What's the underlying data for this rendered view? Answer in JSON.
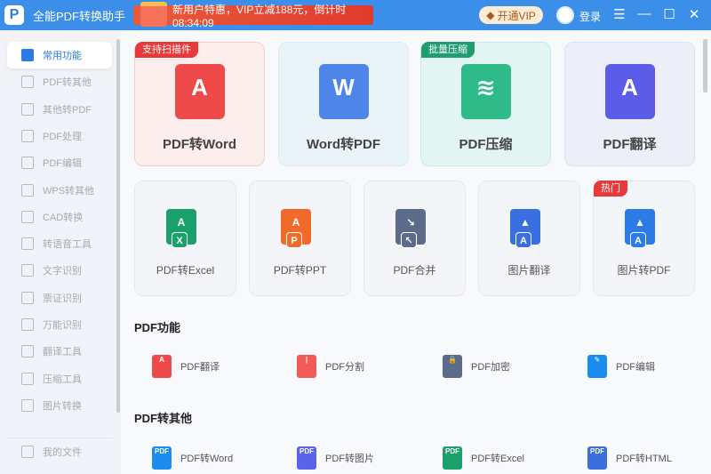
{
  "app": {
    "title": "全能PDF转换助手",
    "promo": "新用户特惠，VIP立减188元，倒计时 08:34:09",
    "vip": "开通VIP",
    "login": "登录"
  },
  "sidebar": {
    "items": [
      {
        "label": "常用功能"
      },
      {
        "label": "PDF转其他"
      },
      {
        "label": "其他转PDF"
      },
      {
        "label": "PDF处理"
      },
      {
        "label": "PDF编辑"
      },
      {
        "label": "WPS转其他"
      },
      {
        "label": "CAD转换"
      },
      {
        "label": "转语音工具"
      },
      {
        "label": "文字识别"
      },
      {
        "label": "票证识别"
      },
      {
        "label": "万能识别"
      },
      {
        "label": "翻译工具"
      },
      {
        "label": "压缩工具"
      },
      {
        "label": "图片转换"
      }
    ],
    "my_files": "我的文件"
  },
  "big_cards": [
    {
      "label": "PDF转Word",
      "tag": "支持扫描件",
      "glyph": "A",
      "color": "#ee4a4a"
    },
    {
      "label": "Word转PDF",
      "glyph": "W",
      "color": "#4d86e8"
    },
    {
      "label": "PDF压缩",
      "tag": "批量压缩",
      "glyph": "≋",
      "color": "#2fba8a"
    },
    {
      "label": "PDF翻译",
      "glyph": "A",
      "color": "#5b5ce8"
    }
  ],
  "small_cards": [
    {
      "label": "PDF转Excel",
      "glyph": "A",
      "badge": "X",
      "color": "#1aa06b"
    },
    {
      "label": "PDF转PPT",
      "glyph": "A",
      "badge": "P",
      "color": "#f06a2a"
    },
    {
      "label": "PDF合并",
      "glyph": "↘",
      "badge": "↖",
      "color": "#5d6b8a"
    },
    {
      "label": "图片翻译",
      "glyph": "▲",
      "badge": "A",
      "color": "#3a6fe0"
    },
    {
      "label": "图片转PDF",
      "glyph": "▲",
      "badge": "A",
      "color": "#2b7be8",
      "tag": "热门"
    }
  ],
  "sections": [
    {
      "title": "PDF功能",
      "items": [
        {
          "label": "PDF翻译",
          "color": "#ee4a4a",
          "glyph": "A"
        },
        {
          "label": "PDF分割",
          "color": "#f25a5a",
          "glyph": "|"
        },
        {
          "label": "PDF加密",
          "color": "#5d6b8a",
          "glyph": "🔒"
        },
        {
          "label": "PDF编辑",
          "color": "#1a8cf0",
          "glyph": "✎"
        }
      ]
    },
    {
      "title": "PDF转其他",
      "items": [
        {
          "label": "PDF转Word",
          "color": "#1a8cf0",
          "glyph": "PDF"
        },
        {
          "label": "PDF转图片",
          "color": "#5b63e8",
          "glyph": "PDF"
        },
        {
          "label": "PDF转Excel",
          "color": "#1aa06b",
          "glyph": "PDF"
        },
        {
          "label": "PDF转HTML",
          "color": "#3a6fe0",
          "glyph": "PDF"
        }
      ]
    }
  ]
}
